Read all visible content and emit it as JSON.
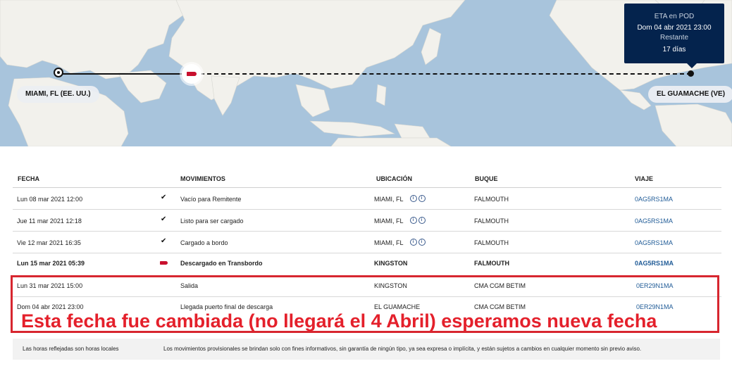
{
  "map": {
    "origin": "MIAMI, FL (EE. UU.)",
    "destination": "EL GUAMACHE (VE)",
    "eta": {
      "title": "ETA en POD",
      "date": "Dom  04 abr 2021 23:00",
      "remaining_label": "Restante",
      "remaining_value": "17 días"
    }
  },
  "table": {
    "headers": {
      "date": "FECHA",
      "movement": "MOVIMIENTOS",
      "location": "UBICACIÓN",
      "vessel": "BUQUE",
      "voyage": "VIAJE"
    },
    "rows": [
      {
        "date": "Lun 08 mar 2021 12:00",
        "status": "check",
        "movement": "Vacío para Remitente",
        "location": "MIAMI, FL",
        "vessel": "FALMOUTH",
        "voyage": "0AG5RS1MA"
      },
      {
        "date": "Jue 11 mar 2021 12:18",
        "status": "check",
        "movement": "Listo para ser cargado",
        "location": "MIAMI, FL",
        "vessel": "FALMOUTH",
        "voyage": "0AG5RS1MA"
      },
      {
        "date": "Vie 12 mar 2021 16:35",
        "status": "check",
        "movement": "Cargado a bordo",
        "location": "MIAMI, FL",
        "vessel": "FALMOUTH",
        "voyage": "0AG5RS1MA"
      },
      {
        "date": "Lun 15 mar 2021 05:39",
        "status": "current",
        "movement": "Descargado en Transbordo",
        "location": "KINGSTON",
        "vessel": "FALMOUTH",
        "voyage": "0AG5RS1MA"
      },
      {
        "date": "Lun 31 mar 2021 15:00",
        "status": "none",
        "movement": "Salida",
        "location": "KINGSTON",
        "vessel": "CMA CGM BETIM",
        "voyage": "0ER29N1MA"
      },
      {
        "date": "Dom  04 abr 2021 23:00",
        "status": "none",
        "movement": "Llegada puerto final de descarga",
        "location": "EL GUAMACHE",
        "vessel": "CMA CGM BETIM",
        "voyage": "0ER29N1MA"
      }
    ]
  },
  "annotation": "Esta fecha fue cambiada (no llegará el 4 Abril) esperamos nueva fecha",
  "footer": {
    "left": "Las horas reflejadas son horas locales",
    "right": "Los movimientos provisionales se brindan solo con fines informativos, sin garantía de ningún tipo, ya sea expresa o implícita, y están sujetos a cambios en cualquier momento sin previo aviso."
  },
  "colors": {
    "accent_red": "#c8102e",
    "annotation_red": "#e4202b",
    "eta_box": "#04234d",
    "voyage_link": "#1e5a96",
    "ocean": "#a8c4dc",
    "land": "#f2f1ec"
  },
  "icons": [
    "check-icon",
    "ship-icon",
    "info-icon"
  ]
}
